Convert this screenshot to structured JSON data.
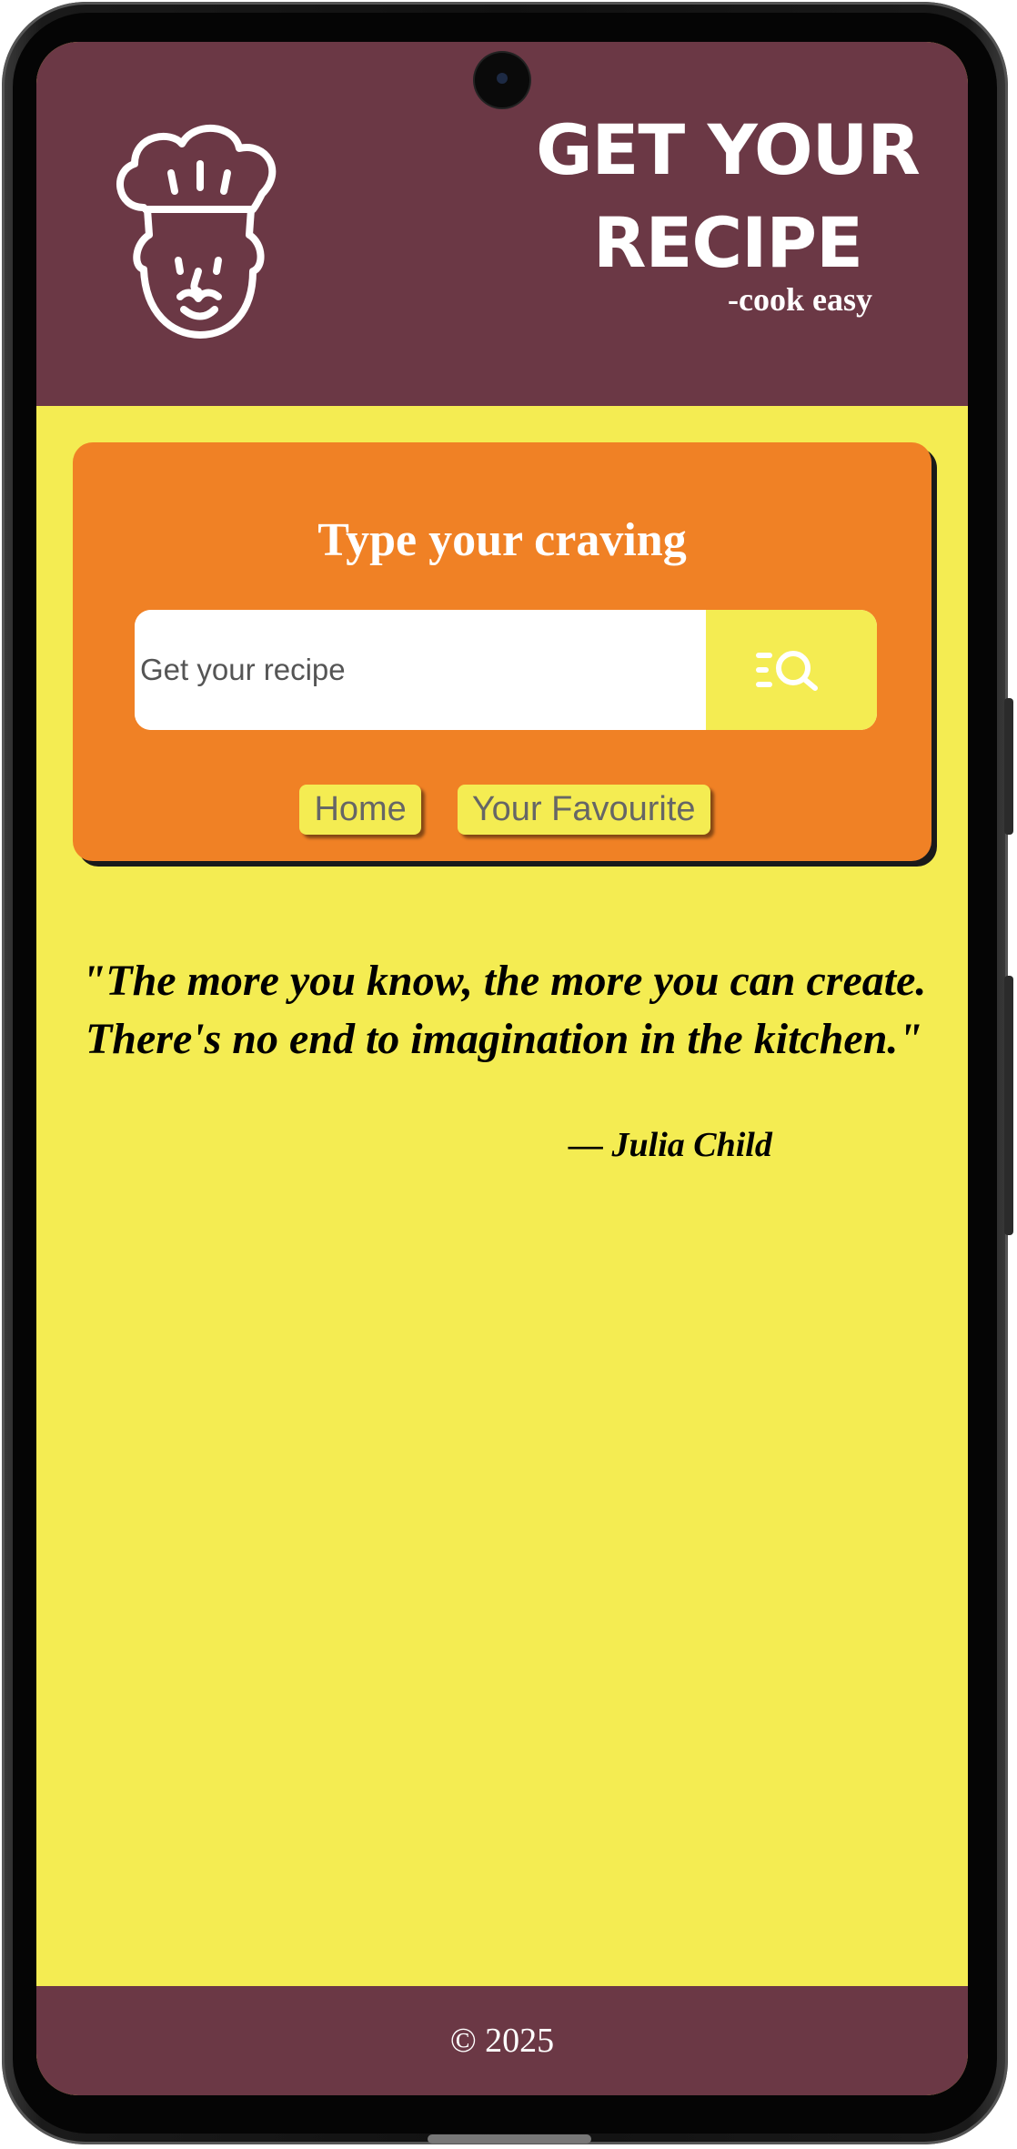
{
  "header": {
    "title": "GET YOUR RECIPE",
    "tagline": "-cook easy",
    "logo_icon": "chef-logo-icon"
  },
  "search_card": {
    "heading": "Type your craving",
    "search_placeholder": "Get your recipe",
    "search_button_icon": "list-search-icon"
  },
  "nav": {
    "home_label": "Home",
    "favourite_label": "Your Favourite"
  },
  "quote": {
    "text": "\"The more you know, the more you can create. There's no end to imagination in the kitchen.\"",
    "author": "— Julia Child"
  },
  "footer": {
    "copyright": "© 2025"
  },
  "colors": {
    "header_bg": "#6b3845",
    "page_bg": "#f4ec52",
    "card_bg": "#f08125",
    "button_bg": "#f4ec52"
  }
}
